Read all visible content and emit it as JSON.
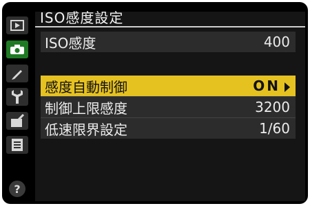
{
  "title": "ISO感度設定",
  "menu": [
    {
      "label": "ISO感度",
      "value": "400"
    },
    {
      "label": "感度自動制御",
      "value": "ON"
    },
    {
      "label": "制御上限感度",
      "value": "3200"
    },
    {
      "label": "低速限界設定",
      "value": "1/60"
    }
  ],
  "sidebar": {
    "items": [
      {
        "icon": "playback-icon"
      },
      {
        "icon": "camera-icon",
        "active": true
      },
      {
        "icon": "pencil-icon"
      },
      {
        "icon": "wrench-icon"
      },
      {
        "icon": "retouch-icon"
      },
      {
        "icon": "list-icon"
      }
    ],
    "help": "?"
  },
  "colors": {
    "highlight": "#e6c221",
    "active_tab": "#1f7a24",
    "row_bg": "#2c2c2c"
  }
}
